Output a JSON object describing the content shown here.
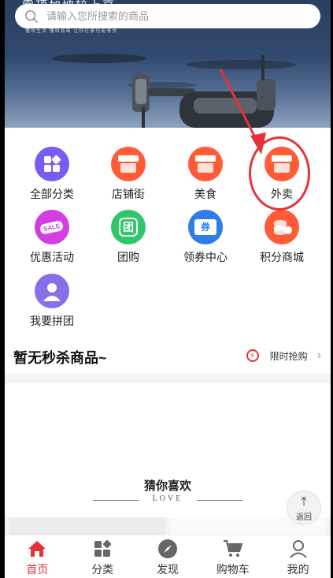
{
  "search": {
    "placeholder": "请输入您所搜索的商品"
  },
  "banner": {
    "headline": "雪顶加坡较上享",
    "subline": "懂得生活 懂得品味 让你在家也能享受"
  },
  "categories": [
    {
      "label": "全部分类",
      "icon": "grid-icon"
    },
    {
      "label": "店铺街",
      "icon": "store-icon"
    },
    {
      "label": "美食",
      "icon": "store-icon"
    },
    {
      "label": "外卖",
      "icon": "store-icon"
    },
    {
      "label": "优惠活动",
      "icon": "sale-icon",
      "badge": "SALE"
    },
    {
      "label": "团购",
      "icon": "group-buy-icon",
      "glyph": "团"
    },
    {
      "label": "领券中心",
      "icon": "coupon-icon",
      "glyph": "券"
    },
    {
      "label": "积分商城",
      "icon": "points-icon"
    },
    {
      "label": "我要拼团",
      "icon": "user-icon"
    }
  ],
  "flash": {
    "title": "暂无秒杀商品~",
    "link": "限时抢购",
    "chevron": "›"
  },
  "guess": {
    "title": "猜你喜欢",
    "subtitle": "LOVE"
  },
  "back_top": {
    "label": "返回"
  },
  "tabs": [
    {
      "label": "首页",
      "icon": "home-icon",
      "active": true
    },
    {
      "label": "分类",
      "icon": "category-icon"
    },
    {
      "label": "发现",
      "icon": "compass-icon"
    },
    {
      "label": "购物车",
      "icon": "cart-icon"
    },
    {
      "label": "我的",
      "icon": "profile-icon"
    }
  ],
  "colors": {
    "accent": "#e5323a",
    "store": "#ff5b37",
    "grid": "#7b5cf0",
    "sale": "#d43de0",
    "groupbuy": "#2fc76a",
    "coupon": "#2f7de8",
    "points": "#ff5b37",
    "pintuan": "#8a6ee8"
  }
}
